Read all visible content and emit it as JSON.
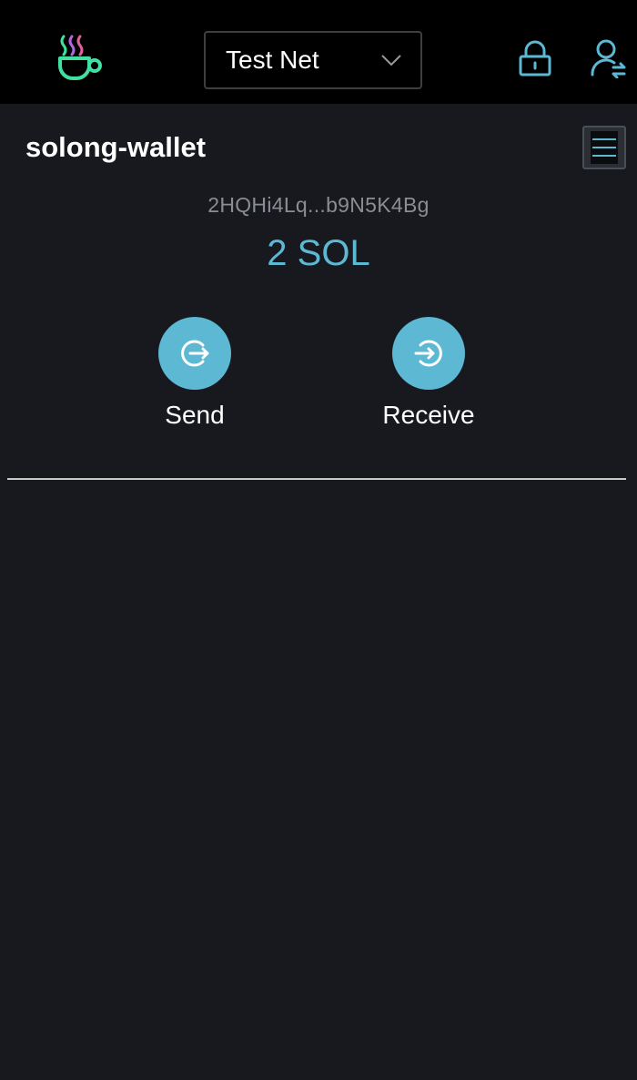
{
  "header": {
    "network": {
      "selected": "Test Net"
    }
  },
  "wallet": {
    "name": "solong-wallet",
    "address": "2HQHi4Lq...b9N5K4Bg",
    "balance": "2 SOL"
  },
  "actions": {
    "send_label": "Send",
    "receive_label": "Receive"
  },
  "icons": {
    "logo": "coffee-cup-logo-icon",
    "network_chevron": "chevron-down-icon",
    "lock": "lock-icon",
    "account": "switch-account-icon",
    "menu": "hamburger-menu-icon",
    "send": "logout-arrow-icon",
    "receive": "login-arrow-icon"
  },
  "colors": {
    "background": "#17191f",
    "header": "#000000",
    "accent": "#5cb8d3",
    "logo_green": "#3fe0a0",
    "logo_purple": "#b266e0",
    "logo_pink": "#e0609a"
  }
}
